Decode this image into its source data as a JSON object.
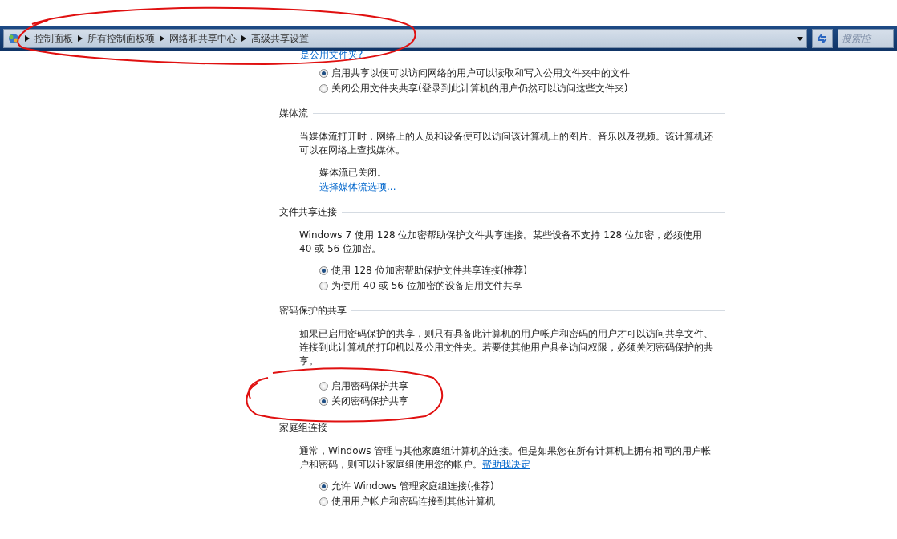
{
  "address_bar": {
    "annotated": true,
    "breadcrumbs": [
      "控制面板",
      "所有控制面板项",
      "网络和共享中心",
      "高级共享设置"
    ],
    "search": {
      "placeholder": "搜索控"
    }
  },
  "top_link": "是公用文件夹?",
  "top_options": [
    {
      "label": "启用共享以便可以访问网络的用户可以读取和写入公用文件夹中的文件",
      "selected": true
    },
    {
      "label": "关闭公用文件夹共享(登录到此计算机的用户仍然可以访问这些文件夹)",
      "selected": false
    }
  ],
  "sections": [
    {
      "title": "媒体流",
      "description": "当媒体流打开时，网络上的人员和设备便可以访问该计算机上的图片、音乐以及视频。该计算机还可以在网络上查找媒体。",
      "status": "媒体流已关闭。",
      "link": "选择媒体流选项..."
    },
    {
      "title": "文件共享连接",
      "description": "Windows 7 使用 128 位加密帮助保护文件共享连接。某些设备不支持 128 位加密，必须使用 40 或 56 位加密。",
      "options": [
        {
          "label": "使用 128 位加密帮助保护文件共享连接(推荐)",
          "selected": true
        },
        {
          "label": "为使用 40 或 56 位加密的设备启用文件共享",
          "selected": false
        }
      ]
    },
    {
      "title": "密码保护的共享",
      "annotated": true,
      "description": "如果已启用密码保护的共享，则只有具备此计算机的用户帐户和密码的用户才可以访问共享文件、连接到此计算机的打印机以及公用文件夹。若要使其他用户具备访问权限，必须关闭密码保护的共享。",
      "options": [
        {
          "label": "启用密码保护共享",
          "selected": false
        },
        {
          "label": "关闭密码保护共享",
          "selected": true
        }
      ]
    },
    {
      "title": "家庭组连接",
      "description": "通常，Windows 管理与其他家庭组计算机的连接。但是如果您在所有计算机上拥有相同的用户帐户和密码，则可以让家庭组使用您的帐户。",
      "inline_link": "帮助我决定",
      "options": [
        {
          "label": "允许 Windows 管理家庭组连接(推荐)",
          "selected": true
        },
        {
          "label": "使用用户帐户和密码连接到其他计算机",
          "selected": false
        }
      ]
    }
  ]
}
